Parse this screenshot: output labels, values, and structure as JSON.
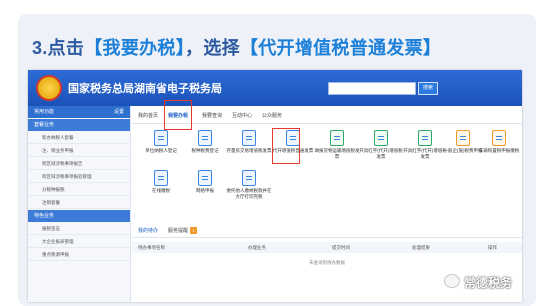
{
  "headline": {
    "prefix": "3.点击",
    "link1": "【我要办税】",
    "mid": "，选择",
    "link2": "【代开增值税普通发票】"
  },
  "portal": {
    "title": "国家税务总局湖南省电子税务局",
    "search_button": "搜索"
  },
  "sidebar": {
    "header_label": "常用功能",
    "header_right": "设置",
    "section1": "套餐业务",
    "section1_items": [
      "新办纳税人套餐",
      "注、销业务申报",
      "跨区域涉税事项报告",
      "跨区域涉税事项报验管理",
      "分税种报税",
      "注销套餐"
    ],
    "section2": "特色业务",
    "section2_items": [
      "报税签证",
      "大企业报表管理",
      "重点税源申报"
    ]
  },
  "tabs": [
    {
      "label": "我的首页",
      "active": false
    },
    {
      "label": "我要办税",
      "active": true
    },
    {
      "label": "我要查询",
      "active": false
    },
    {
      "label": "互动中心",
      "active": false
    },
    {
      "label": "公众服务",
      "active": false
    }
  ],
  "tiles": [
    {
      "label": "单位纳税人登记",
      "color": "blue"
    },
    {
      "label": "税种税费登记",
      "color": "blue"
    },
    {
      "label": "存量房交易增值税发票",
      "color": "blue"
    },
    {
      "label": "代开增值税普通发票",
      "color": "blue",
      "highlight": true
    },
    {
      "label": "填报货物运输增值税发票",
      "color": "green"
    },
    {
      "label": "开具红字(代开)增值税发票",
      "color": "green"
    },
    {
      "label": "开具红字(代开)增值税发票",
      "color": "green"
    },
    {
      "label": "一般企(施)税费申报",
      "color": "orange"
    },
    {
      "label": "车辆购置税申报缴税",
      "color": "orange"
    },
    {
      "label": "在线缴税",
      "color": "blue"
    },
    {
      "label": "网络申报",
      "color": "blue"
    },
    {
      "label": "委托他人缴纳税款并在大厅打印完税",
      "color": "blue"
    }
  ],
  "lower_tabs": [
    {
      "label": "我的待办",
      "active": true
    },
    {
      "label": "服务提醒",
      "active": false,
      "badge": "1"
    }
  ],
  "table_headers": [
    "待办事项名称",
    "办理业务",
    "提交时间",
    "处理结果",
    "操作"
  ],
  "empty_text": "未查询到待办数据",
  "watermark": "常德税务"
}
